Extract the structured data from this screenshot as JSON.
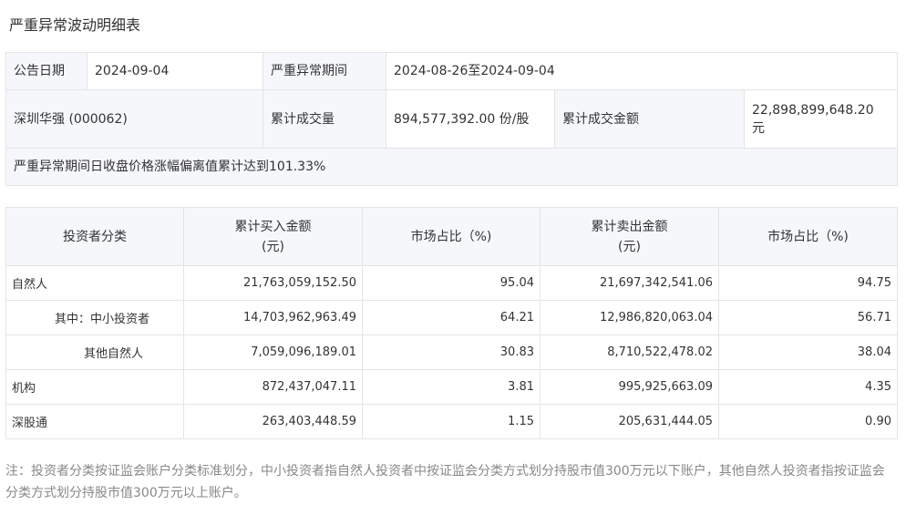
{
  "page": {
    "title": "严重异常波动明细表"
  },
  "info": {
    "announce_date_label": "公告日期",
    "announce_date": "2024-09-04",
    "period_label": "严重异常期间",
    "period": "2024-08-26至2024-09-04",
    "stock": "深圳华强 (000062)",
    "volume_label": "累计成交量",
    "volume": "894,577,392.00 份/股",
    "amount_label": "累计成交金额",
    "amount": "22,898,899,648.20 元",
    "note": "严重异常期间日收盘价格涨幅偏离值累计达到101.33%"
  },
  "detail": {
    "headers": {
      "category": "投资者分类",
      "buy_amount": "累计买入金额",
      "buy_unit": "(元)",
      "buy_share": "市场占比（%)",
      "sell_amount": "累计卖出金额",
      "sell_unit": "(元)",
      "sell_share": "市场占比（%)"
    },
    "rows": [
      {
        "category": "自然人",
        "buy": "21,763,059,152.50",
        "buy_pct": "95.04",
        "sell": "21,697,342,541.06",
        "sell_pct": "94.75"
      },
      {
        "category": "其中：中小投资者",
        "buy": "14,703,962,963.49",
        "buy_pct": "64.21",
        "sell": "12,986,820,063.04",
        "sell_pct": "56.71"
      },
      {
        "category": "其他自然人",
        "buy": "7,059,096,189.01",
        "buy_pct": "30.83",
        "sell": "8,710,522,478.02",
        "sell_pct": "38.04"
      },
      {
        "category": "机构",
        "buy": "872,437,047.11",
        "buy_pct": "3.81",
        "sell": "995,925,663.09",
        "sell_pct": "4.35"
      },
      {
        "category": "深股通",
        "buy": "263,403,448.59",
        "buy_pct": "1.15",
        "sell": "205,631,444.05",
        "sell_pct": "0.90"
      }
    ]
  },
  "footnote": "注：投资者分类按证监会账户分类标准划分，中小投资者指自然人投资者中按证监会分类方式划分持股市值300万元以下账户，其他自然人投资者指按证监会分类方式划分持股市值300万元以上账户。"
}
